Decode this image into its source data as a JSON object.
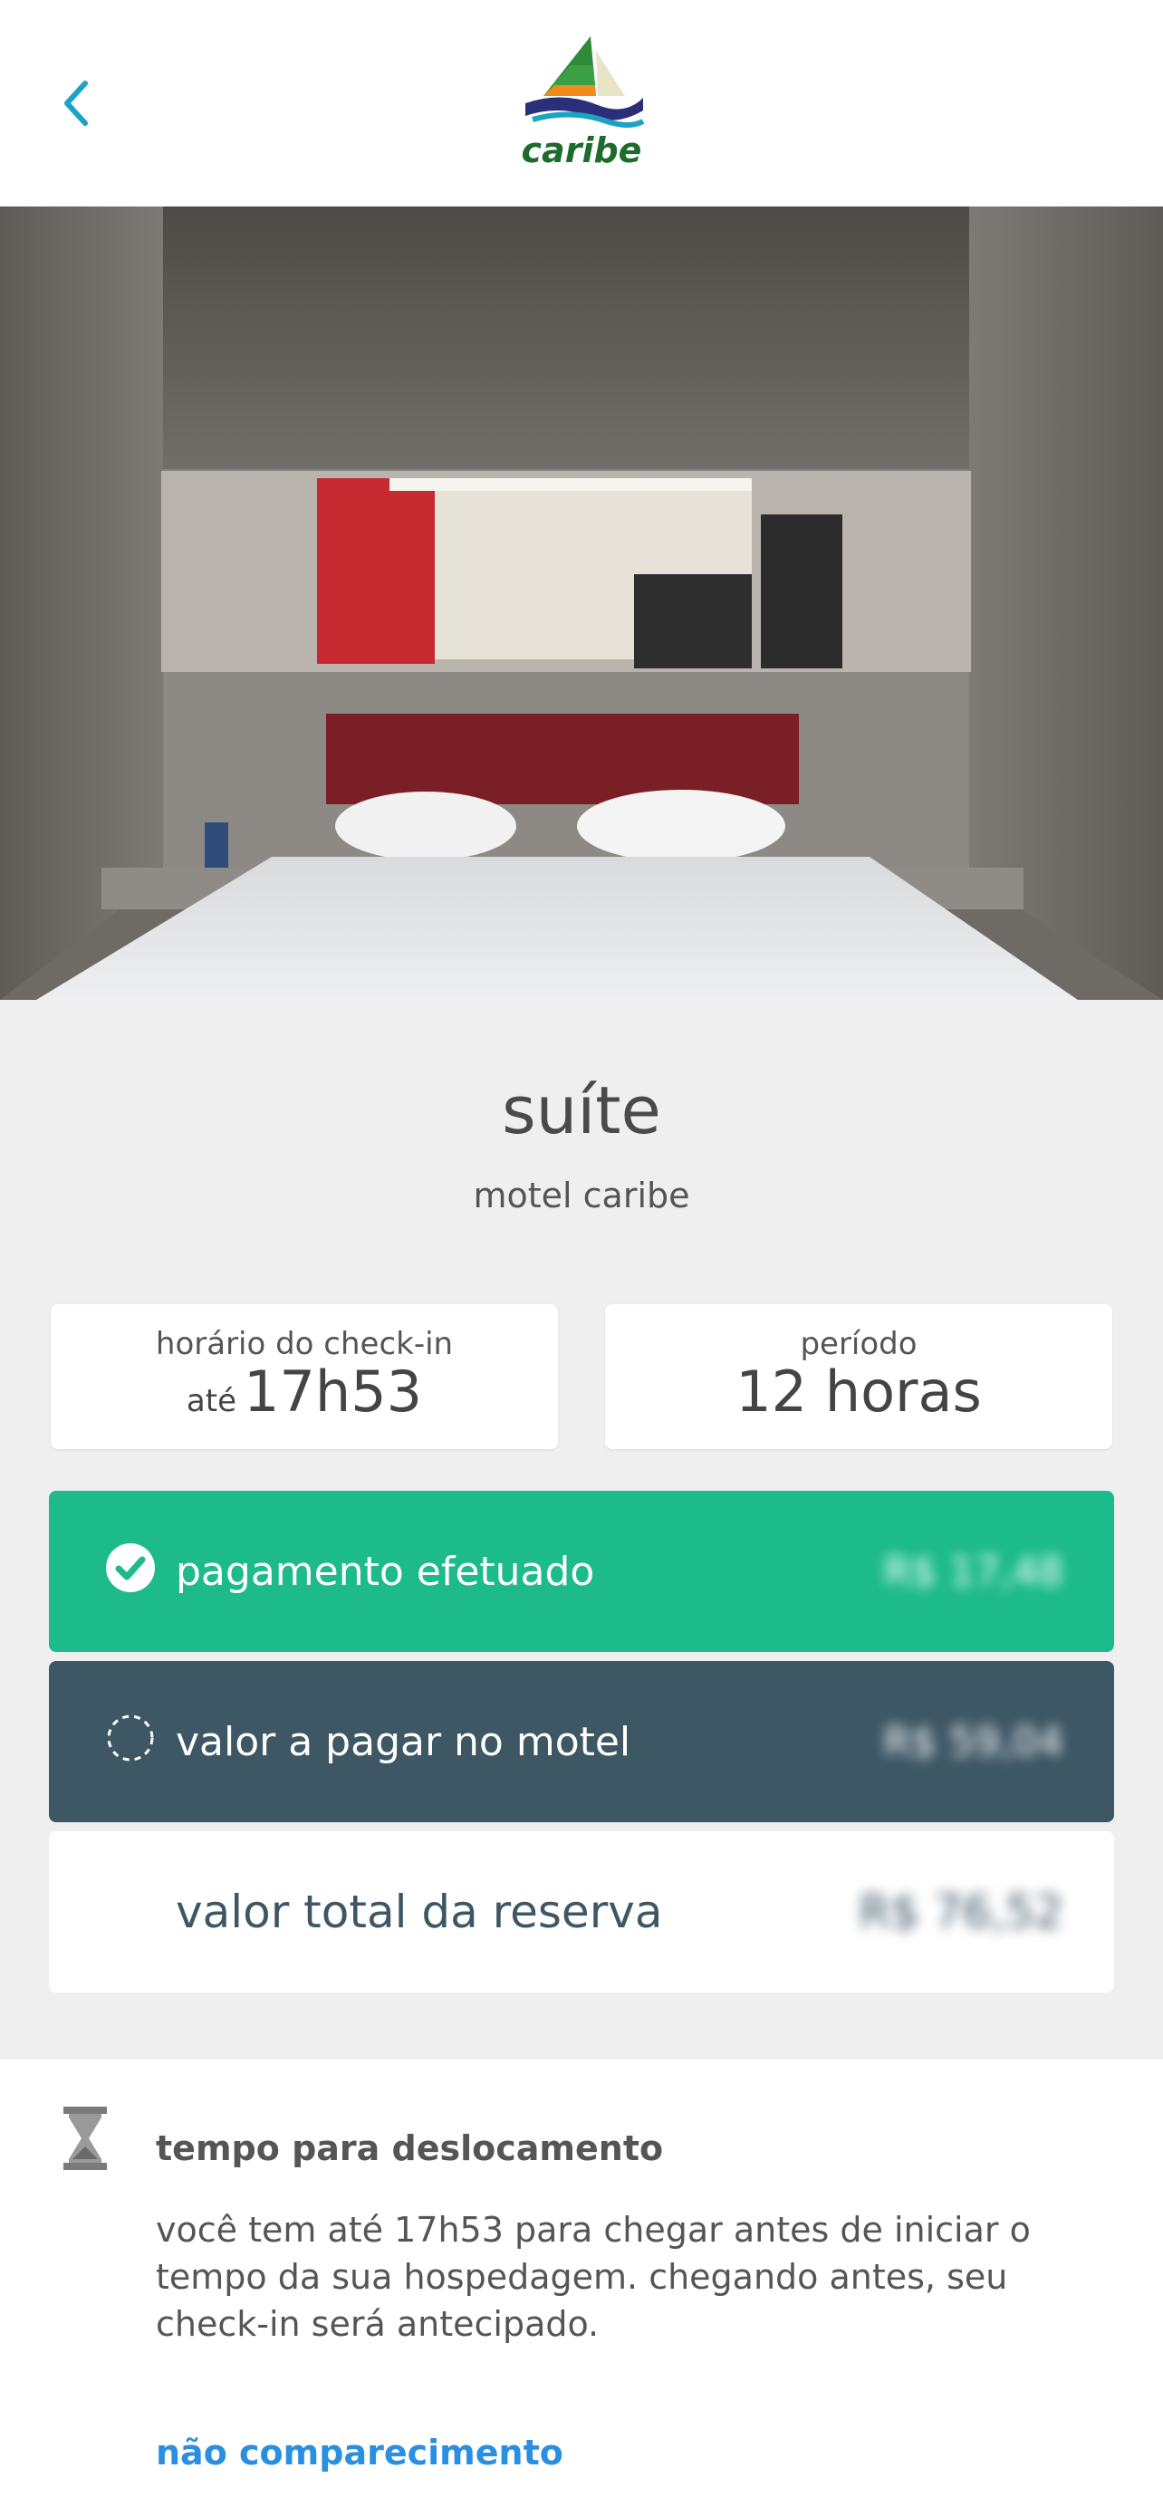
{
  "header": {
    "logo_text": "caribe"
  },
  "room": {
    "title": "suíte",
    "motel_name": "motel caribe"
  },
  "checkin": {
    "label": "horário do check-in",
    "prefix": "até",
    "time": "17h53"
  },
  "period": {
    "label": "período",
    "value": "12 horas"
  },
  "payment_done": {
    "label": "pagamento efetuado",
    "value": "R$ 17,48",
    "color": "#1dba8a"
  },
  "to_pay": {
    "label": "valor a pagar no motel",
    "value": "R$ 59,04",
    "color": "#3e5764"
  },
  "total": {
    "label": "valor total da reserva",
    "value": "R$ 76,52"
  },
  "travel_time": {
    "title": "tempo para deslocamento",
    "text": "você tem até 17h53 para chegar antes de iniciar o tempo da sua hospedagem. chegando antes, seu check-in será antecipado.",
    "link": "não comparecimento"
  },
  "colors": {
    "accent": "#1aa3c2",
    "link": "#2a8fe0"
  }
}
